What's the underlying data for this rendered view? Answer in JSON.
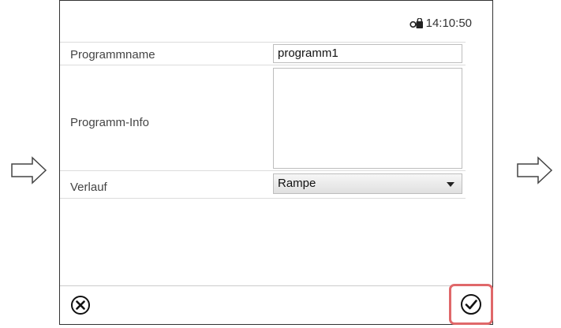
{
  "header": {
    "time": "14:10:50",
    "lock_icon": "lock-key-icon"
  },
  "form": {
    "program_name_label": "Programmname",
    "program_name_value": "programm1",
    "program_info_label": "Programm-Info",
    "program_info_value": "",
    "verlauf_label": "Verlauf",
    "verlauf_value": "Rampe"
  },
  "footer": {
    "cancel_icon": "close-circle-icon",
    "confirm_icon": "check-circle-icon",
    "highlight_color": "#e0686a"
  }
}
